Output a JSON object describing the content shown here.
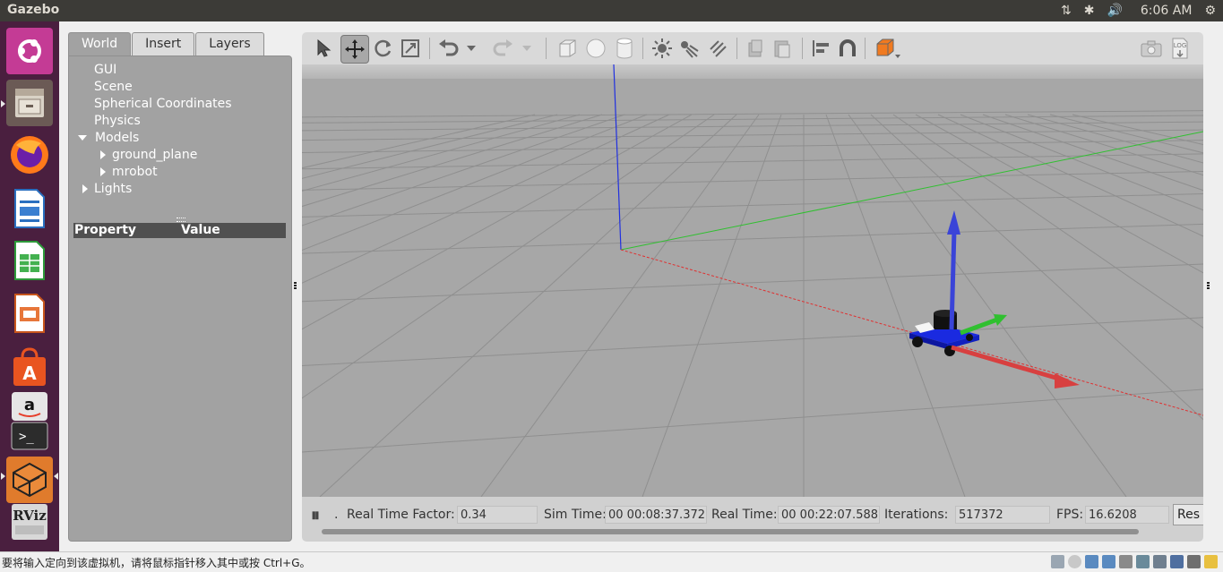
{
  "topbar": {
    "app_title": "Gazebo",
    "clock": "6:06 AM"
  },
  "launcher": {
    "items": [
      "Ubuntu Dash",
      "Files",
      "Firefox",
      "LibreOffice Writer",
      "LibreOffice Calc",
      "LibreOffice Impress",
      "Ubuntu Software",
      "Amazon",
      "Terminal",
      "Gazebo",
      "RViz"
    ]
  },
  "left_panel": {
    "tabs": [
      "World",
      "Insert",
      "Layers"
    ],
    "tree": {
      "gui": "GUI",
      "scene": "Scene",
      "spherical": "Spherical Coordinates",
      "physics": "Physics",
      "models": "Models",
      "ground_plane": "ground_plane",
      "mrobot": "mrobot",
      "lights": "Lights"
    },
    "property_header": "Property",
    "value_header": "Value"
  },
  "toolbar": {
    "icons": [
      "select-icon",
      "translate-icon",
      "rotate-icon",
      "scale-icon",
      "undo-icon",
      "redo-icon",
      "box-icon",
      "sphere-icon",
      "cylinder-icon",
      "point-light-icon",
      "spot-light-icon",
      "directional-light-icon",
      "copy-icon",
      "paste-icon",
      "align-icon",
      "magnet-icon",
      "view-angle-icon",
      "screenshot-icon",
      "log-icon"
    ]
  },
  "status": {
    "pause_symbol": "⏸",
    "step": ".",
    "rtf_label": "Real Time Factor:",
    "rtf_value": "0.34",
    "sim_time_label": "Sim Time:",
    "sim_time_value": "00 00:08:37.372",
    "real_time_label": "Real Time:",
    "real_time_value": "00 00:22:07.588",
    "iterations_label": "Iterations:",
    "iterations_value": "517372",
    "fps_label": "FPS:",
    "fps_value": "16.6208",
    "reset_button": "Res"
  },
  "bottom": {
    "message": "要将输入定向到该虚拟机，请将鼠标指针移入其中或按 Ctrl+G。"
  },
  "colors": {
    "launcher_bg": "#4a1f3f",
    "topbar_bg": "#3c3b37",
    "panel_bg": "#a2a2a2",
    "viewport_bg": "#a9a9a9",
    "x_axis": "#e03030",
    "y_axis": "#30c030",
    "z_axis": "#2040e0",
    "robot_body": "#1a2ae0"
  }
}
